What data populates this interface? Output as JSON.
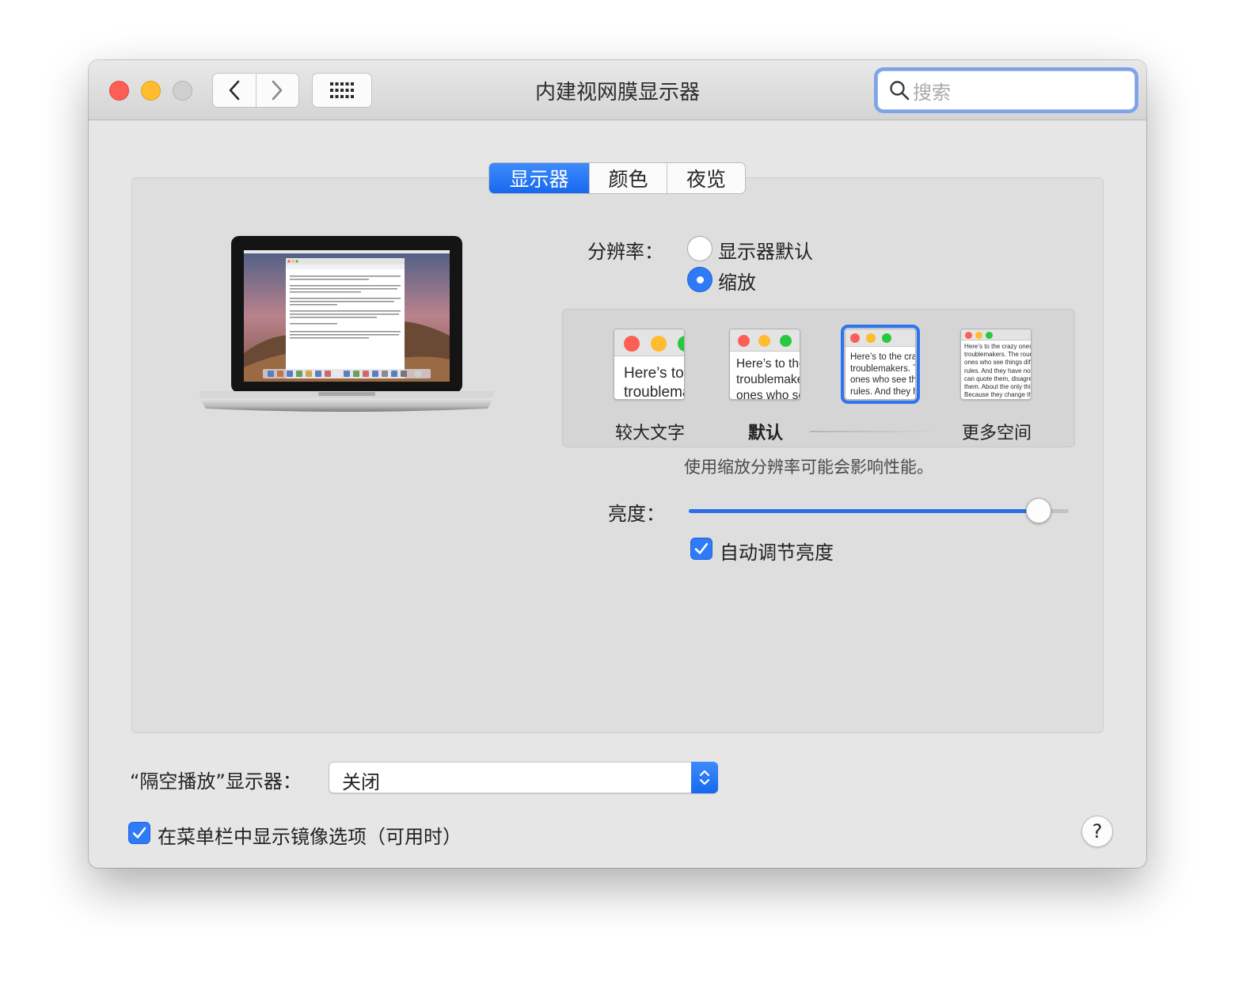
{
  "window": {
    "title": "内建视网膜显示器",
    "search_placeholder": "搜索"
  },
  "tabs": [
    {
      "label": "显示器",
      "active": true
    },
    {
      "label": "颜色",
      "active": false
    },
    {
      "label": "夜览",
      "active": false
    }
  ],
  "resolution": {
    "label": "分辨率：",
    "options": [
      {
        "label": "显示器默认",
        "selected": false
      },
      {
        "label": "缩放",
        "selected": true
      }
    ],
    "scale_options": [
      {
        "label": "较大文字",
        "sample": "Here’s to the\ntroublemakers",
        "selected": false
      },
      {
        "label": "默认",
        "sample": "Here’s to the\ntroublemakers.\nones who see",
        "selected": false
      },
      {
        "label": "",
        "sample": "Here’s to the crazy\ntroublemakers. The\nones who see things\nrules. And they have",
        "selected": true
      },
      {
        "label": "更多空间",
        "sample": "Here’s to the crazy ones\ntroublemakers. The round\nones who see things diff\nrules. And they have no\ncan quote them, disagree\nthem. About the only thi\nBecause they change thi",
        "selected": false
      }
    ],
    "note": "使用缩放分辨率可能会影响性能。"
  },
  "brightness": {
    "label": "亮度：",
    "level": 0.92,
    "auto_label": "自动调节亮度",
    "auto_checked": true
  },
  "airplay": {
    "label": "“隔空播放”显示器：",
    "value": "关闭"
  },
  "mirroring": {
    "label": "在菜单栏中显示镜像选项（可用时）",
    "checked": true
  },
  "help": {
    "label": "?"
  },
  "colors": {
    "accent": "#2f7af6",
    "close": "#fd5f57",
    "minimize": "#febc2e",
    "zoom_disabled": "#cfcfcf"
  }
}
